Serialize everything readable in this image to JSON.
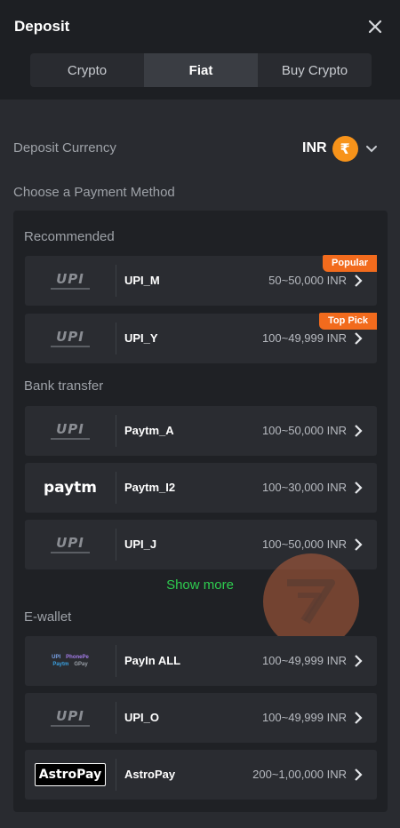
{
  "header": {
    "title": "Deposit",
    "close_icon": "close-icon"
  },
  "tabs": [
    {
      "label": "Crypto",
      "active": false
    },
    {
      "label": "Fiat",
      "active": true
    },
    {
      "label": "Buy Crypto",
      "active": false
    }
  ],
  "currency": {
    "label": "Deposit Currency",
    "code": "INR",
    "symbol": "₹",
    "symbol_color": "#f7931a"
  },
  "payment": {
    "heading": "Choose a Payment Method",
    "show_more": "Show more",
    "sections": {
      "recommended": "Recommended",
      "bank_transfer": "Bank transfer",
      "ewallet": "E-wallet"
    },
    "methods": {
      "upi_m": {
        "logo": "UPI",
        "name": "UPI_M",
        "range": "50~50,000 INR",
        "badge": "Popular"
      },
      "upi_y": {
        "logo": "UPI",
        "name": "UPI_Y",
        "range": "100~49,999 INR",
        "badge": "Top Pick"
      },
      "paytm_a": {
        "logo": "UPI",
        "name": "Paytm_A",
        "range": "100~50,000 INR"
      },
      "paytm_i2": {
        "logo": "paytm",
        "name": "Paytm_I2",
        "range": "100~30,000 INR"
      },
      "upi_j": {
        "logo": "UPI",
        "name": "UPI_J",
        "range": "100~50,000 INR"
      },
      "payin_all": {
        "logo": "payin-multi-logo",
        "name": "PayIn ALL",
        "range": "100~49,999 INR"
      },
      "upi_o": {
        "logo": "UPI",
        "name": "UPI_O",
        "range": "100~49,999 INR"
      },
      "astropay": {
        "logo": "AstroPay",
        "name": "AstroPay",
        "range": "200~1,00,000 INR"
      }
    }
  },
  "colors": {
    "accent_orange": "#f26b1d",
    "show_more_green": "#2ecc4f",
    "background": "#292b30",
    "panel": "#1f2125"
  }
}
